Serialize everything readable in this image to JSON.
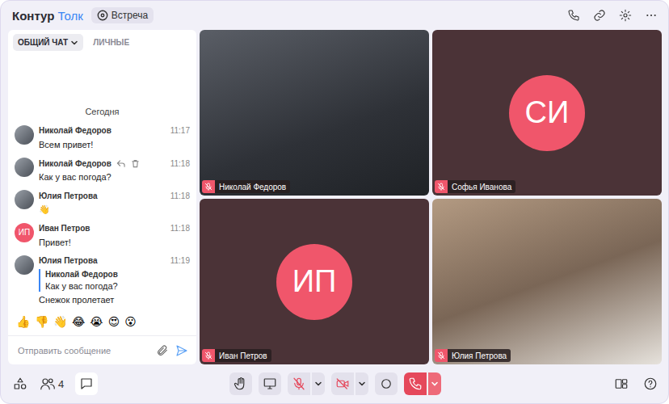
{
  "header": {
    "logo_primary": "Контур",
    "logo_secondary": "Толк",
    "meeting_chip": "Встреча"
  },
  "chat": {
    "tabs": [
      {
        "label": "ОБЩИЙ ЧАТ",
        "selected": true
      },
      {
        "label": "ЛИЧНЫЕ",
        "selected": false
      }
    ],
    "date": "Сегодня",
    "messages": [
      {
        "author": "Николай Федоров",
        "time": "11:17",
        "text": "Всем привет!",
        "avatar_kind": "photo",
        "actions_visible": false
      },
      {
        "author": "Николай Федоров",
        "time": "11:18",
        "text": "Как у вас погода?",
        "avatar_kind": "photo",
        "actions_visible": true
      },
      {
        "author": "Юлия Петрова",
        "time": "11:18",
        "text": "👋",
        "avatar_kind": "photo",
        "actions_visible": false
      },
      {
        "author": "Иван Петров",
        "time": "11:18",
        "text": "Привет!",
        "avatar_kind": "initials",
        "initials": "ИП",
        "actions_visible": false
      },
      {
        "author": "Юлия Петрова",
        "time": "11:19",
        "text": "Снежок пролетает",
        "avatar_kind": "photo",
        "actions_visible": false,
        "quote": {
          "author": "Николай Федоров",
          "text": "Как у вас погода?"
        }
      }
    ],
    "reactions": [
      "👍",
      "👎",
      "👋",
      "😂",
      "😭",
      "😍",
      "😮"
    ],
    "input": {
      "placeholder": "Отправить сообщение"
    }
  },
  "participants": [
    {
      "name": "Николай Федоров",
      "kind": "video",
      "mic_on": false
    },
    {
      "name": "Софья Иванова",
      "kind": "avatar",
      "initials": "СИ",
      "mic_on": false
    },
    {
      "name": "Иван Петров",
      "kind": "avatar",
      "initials": "ИП",
      "mic_on": false
    },
    {
      "name": "Юлия Петрова",
      "kind": "video",
      "mic_on": false
    }
  ],
  "toolbar": {
    "participants_count": "4",
    "chat_open": true,
    "mic_on": false,
    "camera_on": false
  }
}
